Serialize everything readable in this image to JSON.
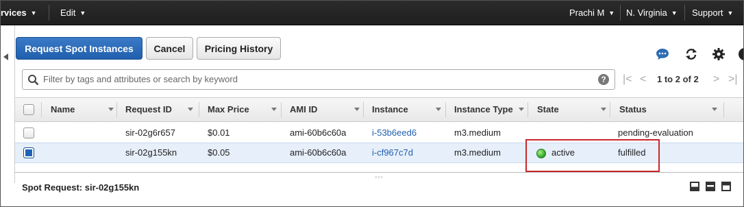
{
  "nav": {
    "services": "rvices",
    "edit": "Edit",
    "user": "Prachi M",
    "region": "N. Virginia",
    "support": "Support"
  },
  "toolbar": {
    "request_button": "Request Spot Instances",
    "cancel_button": "Cancel",
    "pricing_history_button": "Pricing History",
    "icons": [
      "chat-icon",
      "refresh-icon",
      "gear-icon",
      "help-icon"
    ]
  },
  "search": {
    "placeholder": "Filter by tags and attributes or search by keyword"
  },
  "pager": {
    "range": "1 to 2 of 2"
  },
  "table": {
    "columns": [
      "Name",
      "Request ID",
      "Max Price",
      "AMI ID",
      "Instance",
      "Instance Type",
      "State",
      "Status"
    ],
    "rows": [
      {
        "name": "",
        "request_id": "sir-02g6r657",
        "max_price": "$0.01",
        "ami_id": "ami-60b6c60a",
        "instance": "i-53b6eed6",
        "instance_type": "m3.medium",
        "state": "",
        "status": "pending-evaluation",
        "selected": false
      },
      {
        "name": "",
        "request_id": "sir-02g155kn",
        "max_price": "$0.05",
        "ami_id": "ami-60b6c60a",
        "instance": "i-cf967c7d",
        "instance_type": "m3.medium",
        "state": "active",
        "status": "fulfilled",
        "selected": true
      }
    ]
  },
  "detail": {
    "label": "Spot Request: sir-02g155kn"
  },
  "colors": {
    "nav_bg": "#232f3e",
    "primary": "#1f5fae",
    "link": "#1f5fae",
    "selected_row": "#e6effa",
    "highlight_border": "#c8272b",
    "active_dot": "#2aa12a"
  }
}
